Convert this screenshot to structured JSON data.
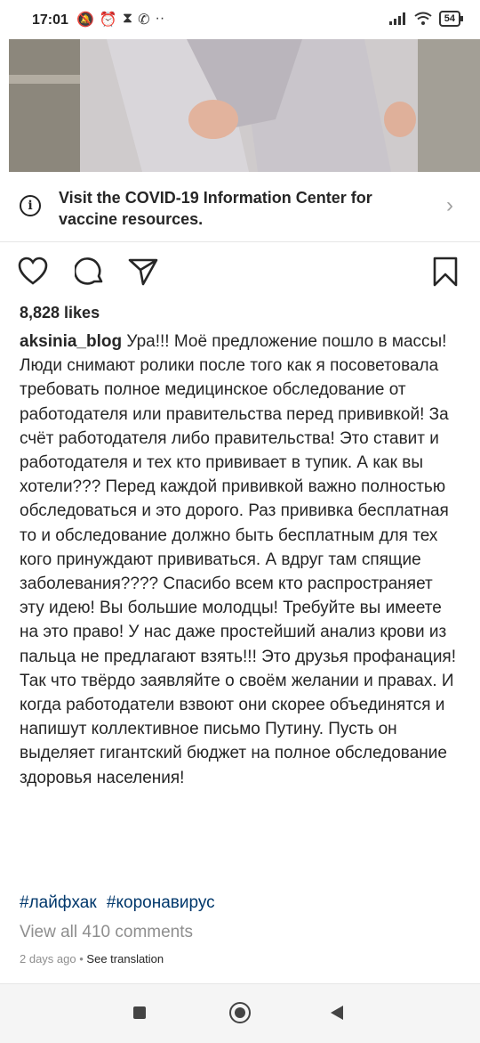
{
  "status_bar": {
    "time": "17:01",
    "icons": [
      "mute-icon",
      "alarm-icon",
      "hourglass-icon",
      "whatsapp-icon",
      "more-icon"
    ],
    "battery": "54"
  },
  "info_banner": {
    "text": "Visit the COVID-19 Information Center for vaccine resources."
  },
  "actions": [
    "heart-icon",
    "comment-icon",
    "share-icon",
    "bookmark-icon"
  ],
  "post": {
    "likes": "8,828 likes",
    "username": "aksinia_blog",
    "caption": "Ура!!! Моё предложение пошло в массы! Люди снимают ролики после того как я посоветовала требовать полное медицинское обследование от работодателя или правительства перед прививкой! За счёт работодателя либо правительства! Это ставит и работодателя и тех кто прививает в тупик. А как вы хотели??? Перед каждой прививкой важно полностью обследоваться и это дорого. Раз прививка бесплатная то и обследование должно быть бесплатным для тех кого принуждают прививаться. А вдруг там спящие заболевания???? Спасибо всем кто распространяет эту идею! Вы большие молодцы! Требуйте вы имеете на это право! У нас даже простейший анализ крови из пальца не предлагают взять!!! Это друзья профанация! Так что твёрдо заявляйте о своём желании и правах. И когда работодатели взвоют они скорее объединятся и напишут коллективное письмо Путину. Пусть он выделяет гигантский бюджет на полное обследование здоровья населения!",
    "hashtags": [
      "#лайфхак",
      "#коронавирус"
    ],
    "view_comments": "View all 410 comments",
    "time_ago": "2 days ago",
    "separator": "•",
    "see_translation": "See translation"
  }
}
